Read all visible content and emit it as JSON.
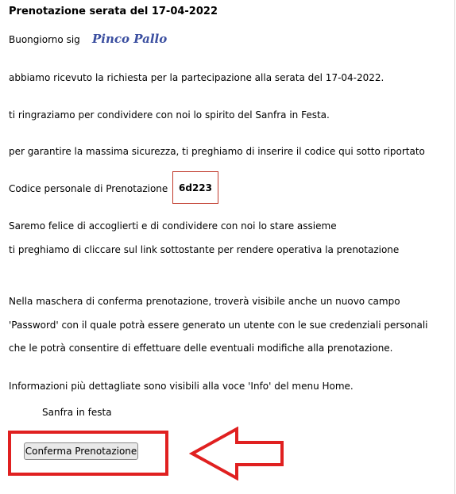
{
  "header": {
    "title": "Prenotazione serata del 17-04-2022"
  },
  "greeting": {
    "prefix": "Buongiorno sig",
    "name": "Pinco Pallo"
  },
  "body": {
    "p1": "abbiamo ricevuto la richiesta per la partecipazione alla serata del 17-04-2022.",
    "p2": "ti ringraziamo per condividere con noi lo spirito del Sanfra in Festa.",
    "p3": "per garantire la massima sicurezza, ti preghiamo di inserire il codice qui sotto riportato",
    "code_label": "Codice personale di Prenotazione",
    "code_value": "6d223",
    "p4": "Saremo felice di accoglierti e di condividere con noi lo stare assieme",
    "p5": "ti preghiamo di cliccare sul link sottostante per rendere operativa la prenotazione",
    "p6": "Nella maschera di conferma prenotazione, troverà visibile anche un nuovo campo",
    "p7": "'Password' con il quale potrà essere generato un utente con le sue credenziali personali",
    "p8": "che le potrà consentire di effettuare delle eventuali modifiche alla prenotazione.",
    "p9": "Informazioni più dettagliate sono visibili alla voce 'Info' del menu Home.",
    "signature": "Sanfra in festa"
  },
  "actions": {
    "confirm_label": "Conferma Prenotazione"
  },
  "annotation": {
    "highlight_color": "#e02020",
    "arrow_icon": "left-arrow-icon"
  }
}
